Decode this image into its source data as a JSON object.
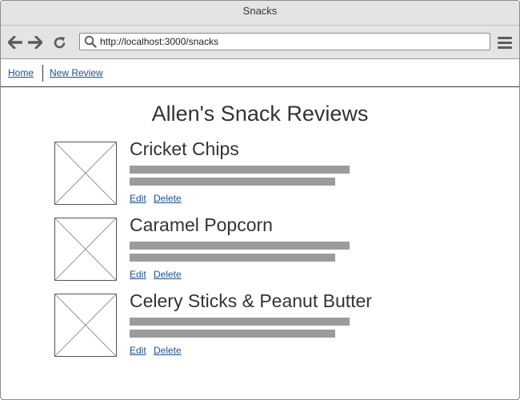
{
  "window": {
    "title": "Snacks"
  },
  "browser": {
    "url": "http://localhost:3000/snacks",
    "back_icon": "arrow-left-icon",
    "forward_icon": "arrow-right-icon",
    "reload_icon": "reload-icon",
    "search_icon": "search-icon",
    "menu_icon": "hamburger-menu-icon"
  },
  "nav": {
    "home": "Home",
    "new_review": "New Review"
  },
  "page": {
    "title": "Allen's Snack Reviews"
  },
  "items": [
    {
      "title": "Cricket Chips",
      "edit": "Edit",
      "delete": "Delete"
    },
    {
      "title": "Caramel Popcorn",
      "edit": "Edit",
      "delete": "Delete"
    },
    {
      "title": "Celery Sticks & Peanut Butter",
      "edit": "Edit",
      "delete": "Delete"
    }
  ],
  "colors": {
    "link": "#1f4f8f",
    "placeholder_text_bar": "#9b9b9b",
    "chrome": "#e4e4e4"
  }
}
